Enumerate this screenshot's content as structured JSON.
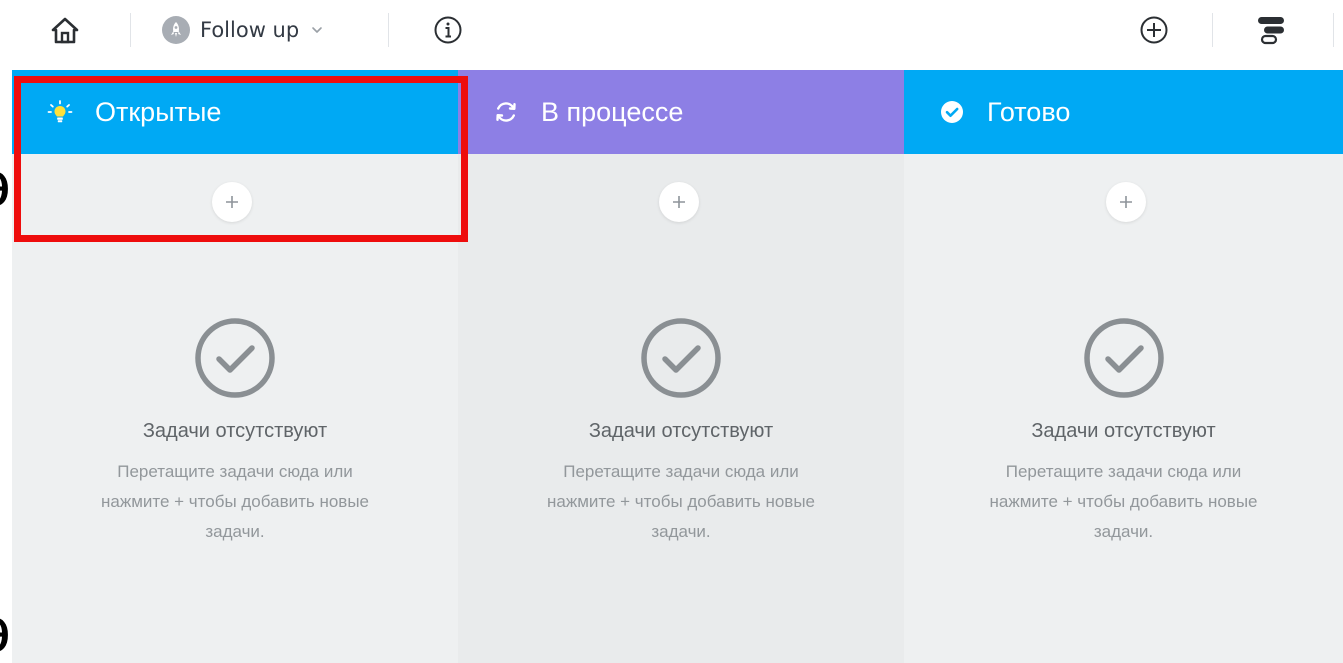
{
  "toolbar": {
    "home_icon": "home-icon",
    "project": {
      "name": "Follow up",
      "avatar_icon": "rocket-icon",
      "dropdown_icon": "chevron-down-icon"
    },
    "info_icon": "info-icon",
    "add_icon": "plus-circle-icon",
    "settings_icon": "sliders-icon"
  },
  "columns": [
    {
      "title": "Открытые",
      "icon": "lightbulb-icon",
      "color": "#00a9f4",
      "add_label": "+",
      "empty_title": "Задачи отсутствуют",
      "empty_desc": "Перетащите задачи сюда или нажмите + чтобы добавить новые задачи."
    },
    {
      "title": "В процессе",
      "icon": "refresh-icon",
      "color": "#8d7fe5",
      "add_label": "+",
      "empty_title": "Задачи отсутствуют",
      "empty_desc": "Перетащите задачи сюда или нажмите + чтобы добавить новые задачи."
    },
    {
      "title": "Готово",
      "icon": "check-circle-icon",
      "color": "#00a9f4",
      "add_label": "+",
      "empty_title": "Задачи отсутствуют",
      "empty_desc": "Перетащите задачи сюда или нажмите + чтобы добавить новые задачи."
    }
  ],
  "highlight": {
    "color": "#ee0d0d",
    "target": "Открытые"
  },
  "colors": {
    "accent_blue": "#00a9f4",
    "accent_purple": "#8d7fe5",
    "board_bg": "#eef0f1",
    "text_muted": "#92979b"
  }
}
